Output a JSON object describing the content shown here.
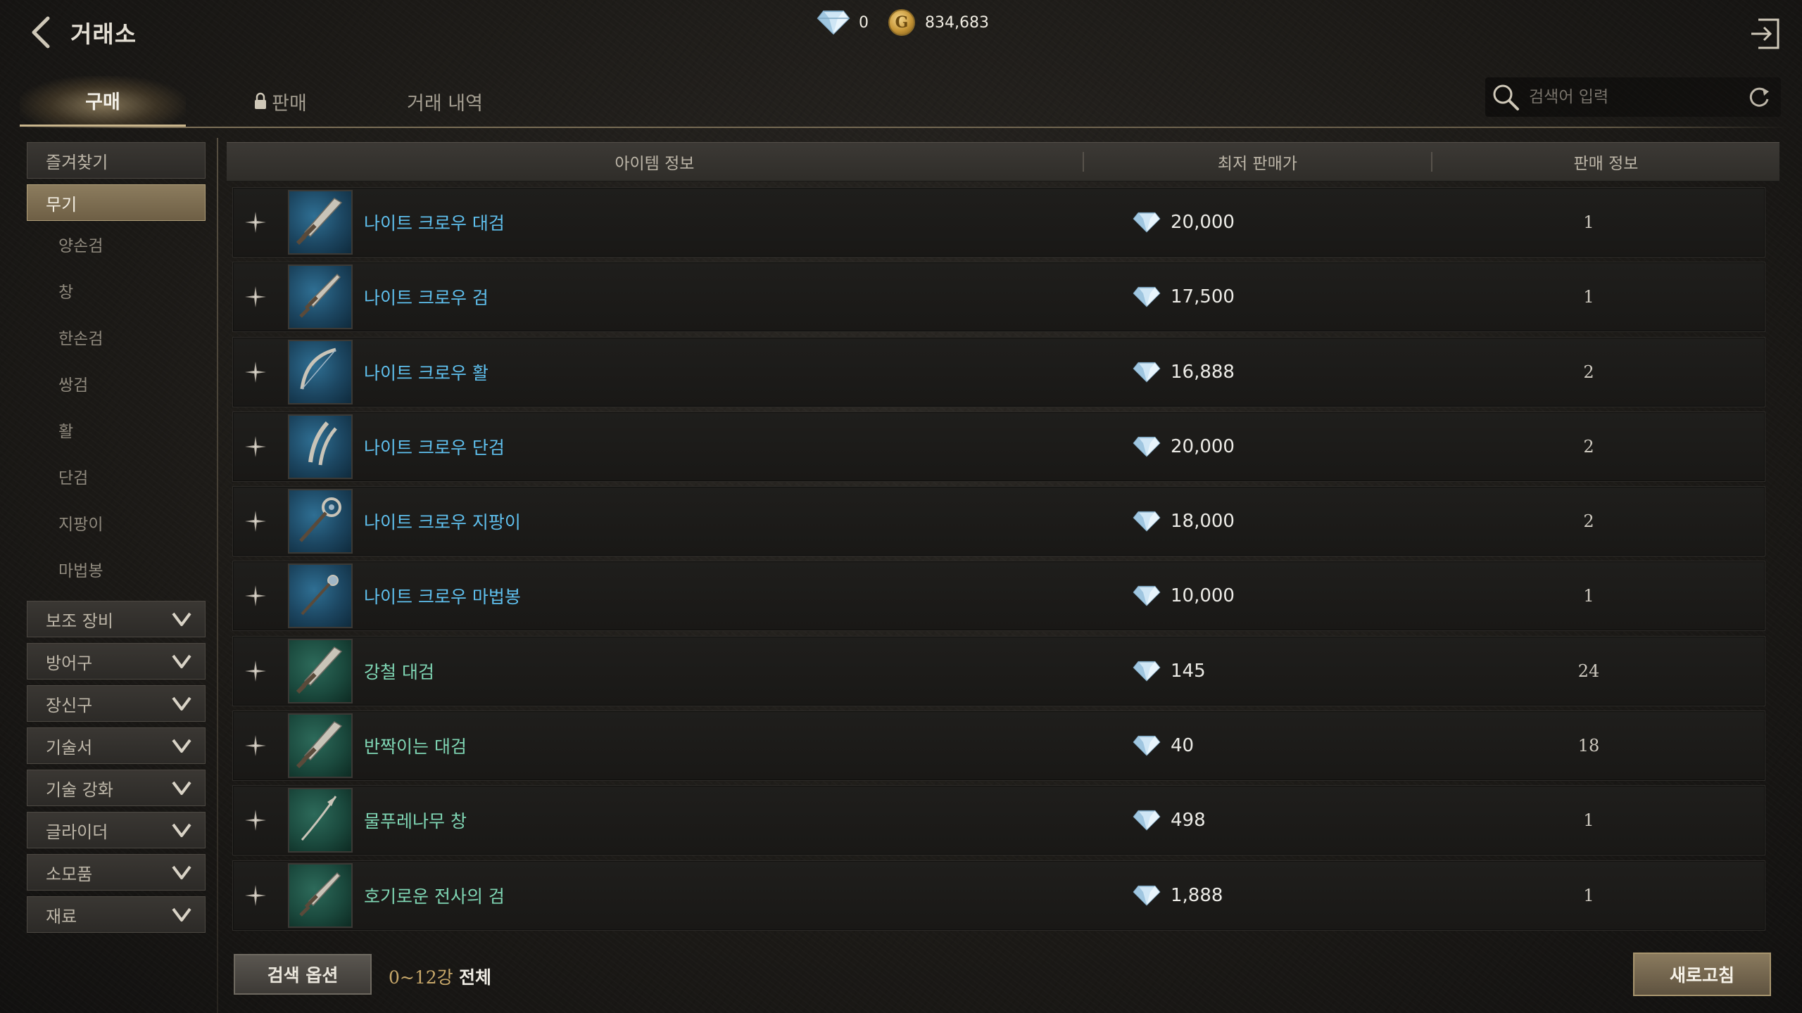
{
  "header": {
    "title": "거래소",
    "diamonds": "0",
    "gold": "834,683",
    "gold_symbol": "G"
  },
  "tabs": [
    {
      "label": "구매",
      "active": true
    },
    {
      "label": "판매",
      "locked": true
    },
    {
      "label": "거래 내역"
    }
  ],
  "search": {
    "placeholder": "검색어 입력"
  },
  "sidebar": {
    "favorites": "즐겨찾기",
    "weapons": "무기",
    "weapon_sub": [
      "양손검",
      "창",
      "한손검",
      "쌍검",
      "활",
      "단검",
      "지팡이",
      "마법봉"
    ],
    "categories": [
      "보조 장비",
      "방어구",
      "장신구",
      "기술서",
      "기술 강화",
      "글라이더",
      "소모품",
      "재료"
    ]
  },
  "table": {
    "headers": [
      "아이템 정보",
      "최저 판매가",
      "판매 정보"
    ],
    "rows": [
      {
        "name": "나이트 크로우 대검",
        "price": "20,000",
        "count": "1",
        "grade": "blue",
        "icon": "greatsword-icon"
      },
      {
        "name": "나이트 크로우 검",
        "price": "17,500",
        "count": "1",
        "grade": "blue",
        "icon": "sword-icon"
      },
      {
        "name": "나이트 크로우 활",
        "price": "16,888",
        "count": "2",
        "grade": "blue",
        "icon": "bow-icon"
      },
      {
        "name": "나이트 크로우 단검",
        "price": "20,000",
        "count": "2",
        "grade": "blue",
        "icon": "dagger-icon"
      },
      {
        "name": "나이트 크로우 지팡이",
        "price": "18,000",
        "count": "2",
        "grade": "blue",
        "icon": "staff-icon"
      },
      {
        "name": "나이트 크로우 마법봉",
        "price": "10,000",
        "count": "1",
        "grade": "blue",
        "icon": "wand-icon"
      },
      {
        "name": "강철 대검",
        "price": "145",
        "count": "24",
        "grade": "green",
        "icon": "greatsword-icon"
      },
      {
        "name": "반짝이는 대검",
        "price": "40",
        "count": "18",
        "grade": "green",
        "icon": "greatsword-icon"
      },
      {
        "name": "물푸레나무 창",
        "price": "498",
        "count": "1",
        "grade": "green",
        "icon": "spear-icon"
      },
      {
        "name": "호기로운 전사의 검",
        "price": "1,888",
        "count": "1",
        "grade": "green",
        "icon": "sword-icon"
      }
    ]
  },
  "footer": {
    "search_options": "검색 옵션",
    "range": "0~12강",
    "scope": "전체",
    "refresh": "새로고침"
  },
  "colors": {
    "blue_grade": "#5fc0ee",
    "green_grade": "#7fd6b4",
    "selected_category": "#8c7c5e"
  }
}
